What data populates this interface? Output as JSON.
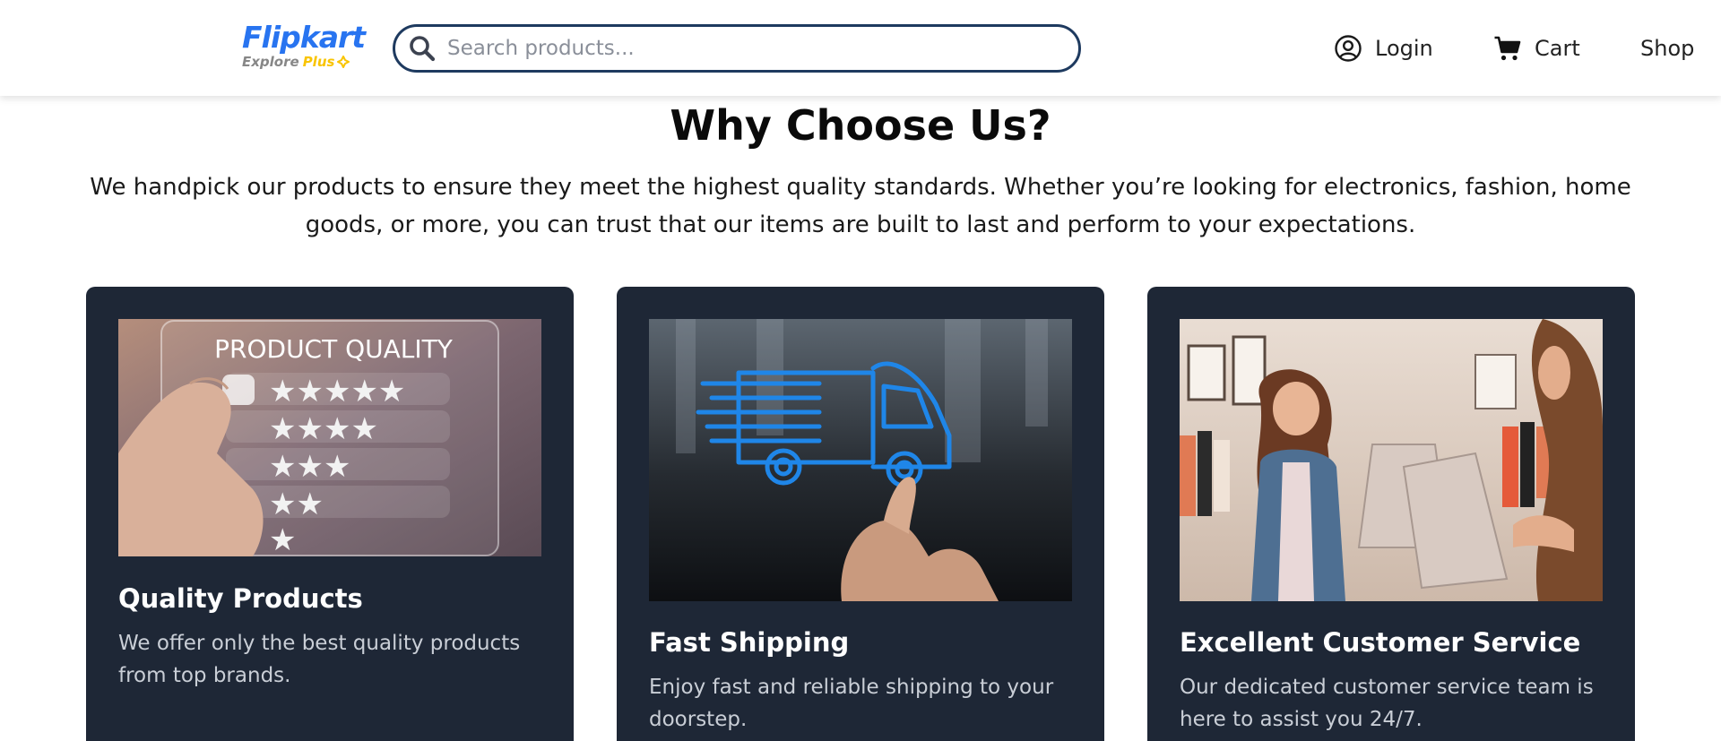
{
  "header": {
    "logo": {
      "name": "Flipkart",
      "tagline_prefix": "Explore",
      "tagline_suffix": "Plus"
    },
    "search": {
      "placeholder": "Search products...",
      "value": ""
    },
    "nav": {
      "login": {
        "label": "Login",
        "icon": "user-circle-icon"
      },
      "cart": {
        "label": "Cart",
        "icon": "cart-icon"
      },
      "shop": {
        "label": "Shop"
      }
    }
  },
  "main": {
    "title": "Why Choose Us?",
    "description": "We handpick our products to ensure they meet the highest quality standards. Whether you’re looking for electronics, fashion, home goods, or more, you can trust that our items are built to last and perform to your expectations.",
    "cards": [
      {
        "image": "product-quality-image",
        "image_caption": "PRODUCT QUALITY",
        "title": "Quality Products",
        "text": "We offer only the best quality products from top brands."
      },
      {
        "image": "delivery-truck-image",
        "title": "Fast Shipping",
        "text": "Enjoy fast and reliable shipping to your doorstep."
      },
      {
        "image": "shopping-customers-image",
        "title": "Excellent Customer Service",
        "text": "Our dedicated customer service team is here to assist you 24/7."
      }
    ]
  },
  "colors": {
    "brand_blue": "#2874f0",
    "brand_yellow": "#f9c400",
    "search_border": "#1e3a5f",
    "card_bg": "#1e2736",
    "card_text": "#c9ced6"
  }
}
